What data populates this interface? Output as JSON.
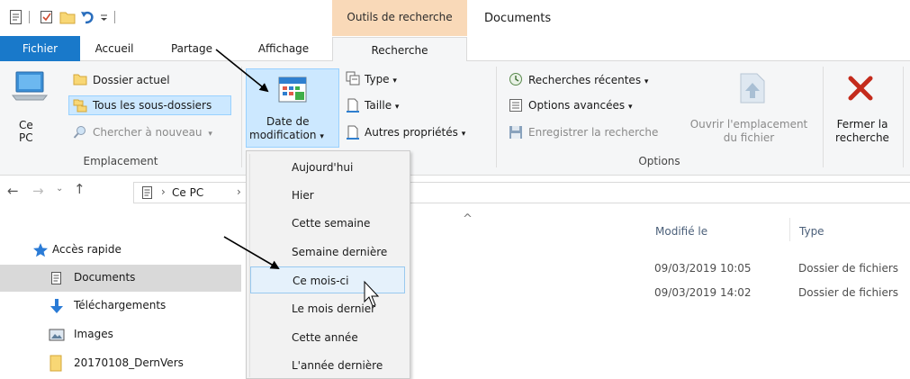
{
  "titlebar": {
    "context_tab_label": "Outils de recherche",
    "window_title": "Documents"
  },
  "tabs": {
    "fichier": "Fichier",
    "accueil": "Accueil",
    "partage": "Partage",
    "affichage": "Affichage",
    "recherche": "Recherche"
  },
  "ribbon": {
    "emplacement": {
      "ce_pc_line1": "Ce",
      "ce_pc_line2": "PC",
      "dossier_actuel": "Dossier actuel",
      "tous_sous_dossiers": "Tous les sous-dossiers",
      "chercher_nouveau": "Chercher à nouveau",
      "group_label": "Emplacement"
    },
    "affiner": {
      "date_modif_line1": "Date de",
      "date_modif_line2": "modification",
      "type": "Type",
      "taille": "Taille",
      "autres_proprietes": "Autres propriétés"
    },
    "options": {
      "recherches_recentes": "Recherches récentes",
      "options_avancees": "Options avancées",
      "enregistrer": "Enregistrer la recherche",
      "ouvrir_line1": "Ouvrir l'emplacement",
      "ouvrir_line2": "du fichier",
      "fermer_line1": "Fermer la",
      "fermer_line2": "recherche",
      "group_label": "Options"
    }
  },
  "navbar": {
    "breadcrumb_ce_pc": "Ce PC"
  },
  "nav_pane": {
    "acces_rapide": "Accès rapide",
    "documents": "Documents",
    "telechargements": "Téléchargements",
    "images": "Images",
    "folder": "20170108_DernVers"
  },
  "file_list": {
    "columns": {
      "modifie_le": "Modifié le",
      "type": "Type"
    },
    "rows": [
      {
        "modified": "09/03/2019 10:05",
        "type": "Dossier de fichiers"
      },
      {
        "modified": "09/03/2019 14:02",
        "type": "Dossier de fichiers"
      }
    ]
  },
  "dropdown": {
    "items": [
      "Aujourd'hui",
      "Hier",
      "Cette semaine",
      "Semaine dernière",
      "Ce mois-ci",
      "Le mois dernier",
      "Cette année",
      "L'année dernière"
    ],
    "highlighted": "Ce mois-ci"
  },
  "colors": {
    "file_tab_blue": "#1979ca",
    "context_tab_orange": "#f9d9b8",
    "selection_blue": "#cce8ff",
    "close_red": "#c42b1c"
  }
}
